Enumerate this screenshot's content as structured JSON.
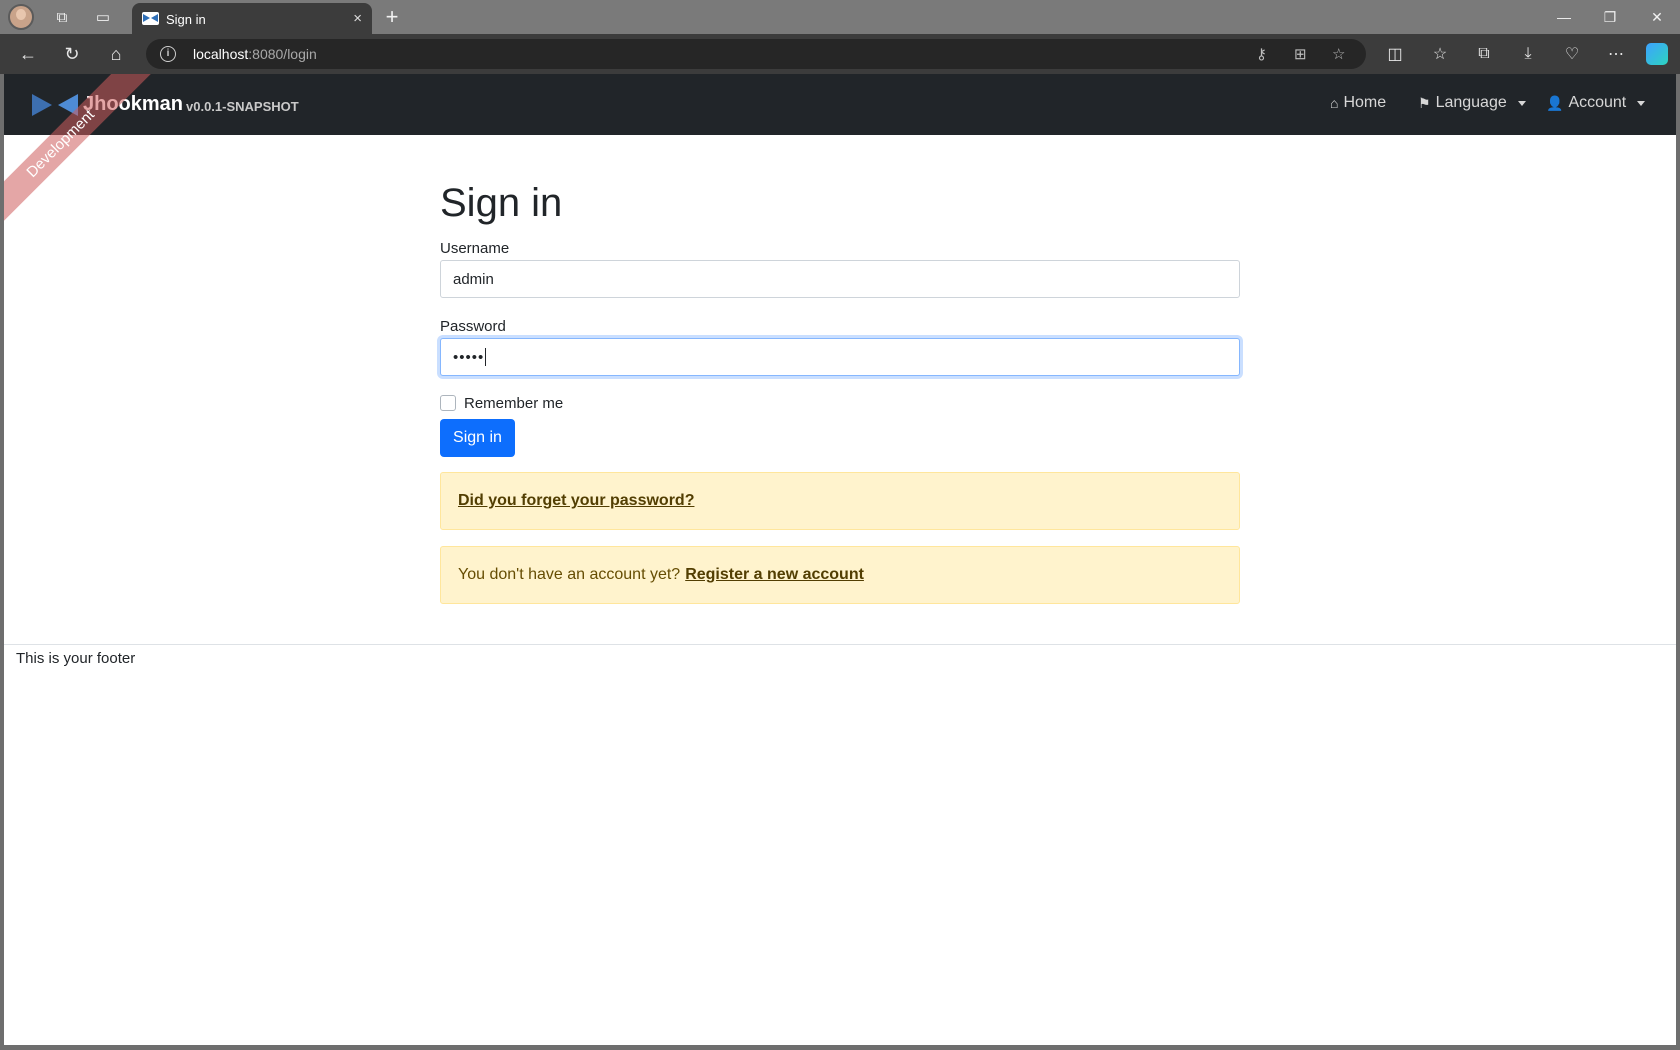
{
  "browser": {
    "tab_title": "Sign in",
    "tab_close": "×",
    "new_tab": "+",
    "url_host": "localhost",
    "url_rest": ":8080/login",
    "icons": [
      "profile-avatar",
      "workspaces-icon",
      "tab-actions-icon",
      "back-icon",
      "refresh-icon",
      "home-icon",
      "site-info-icon",
      "key-icon",
      "app-install-icon",
      "favorite-star-icon",
      "split-screen-icon",
      "favorites-icon",
      "collections-icon",
      "downloads-icon",
      "browser-essentials-icon",
      "more-icon",
      "copilot-icon"
    ]
  },
  "navbar": {
    "brand_name": "Jhookman",
    "brand_version": "v0.0.1-SNAPSHOT",
    "ribbon": "Development",
    "home": "Home",
    "language": "Language",
    "account": "Account"
  },
  "login": {
    "title": "Sign in",
    "username_label": "Username",
    "username_value": "admin",
    "password_label": "Password",
    "password_value": "•••••",
    "remember_label": "Remember me",
    "remember_checked": false,
    "submit_label": "Sign in",
    "forgot_link": "Did you forget your password?",
    "no_account_text": "You don't have an account yet?",
    "register_link": "Register a new account"
  },
  "footer": {
    "text": "This is your footer"
  },
  "colors": {
    "navbar_bg": "#212529",
    "primary": "#0d6efd",
    "alert_bg": "#fff3cd",
    "ribbon": "#cd5c5c"
  }
}
